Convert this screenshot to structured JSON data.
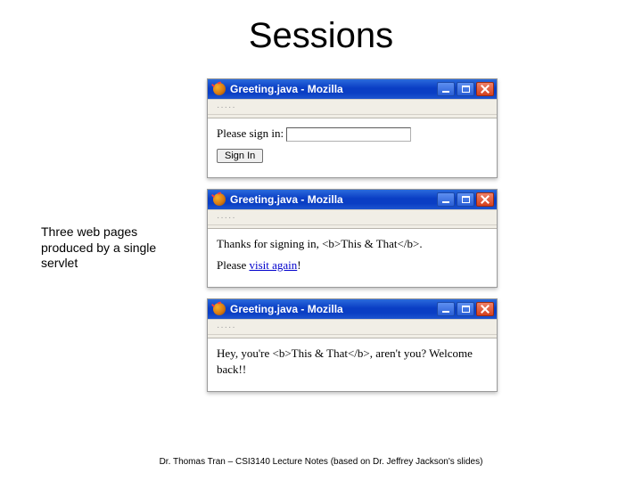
{
  "title": "Sessions",
  "caption": "Three web pages produced by a single servlet",
  "footer": "Dr. Thomas Tran – CSI3140 Lecture Notes (based on Dr. Jeffrey Jackson's slides)",
  "window_title": "Greeting.java - Mozilla",
  "menubar_placeholder": "·····",
  "win1": {
    "label": "Please sign in:",
    "input_value": "",
    "button": "Sign In"
  },
  "win2": {
    "line1": "Thanks for signing in, <b>This & That</b>.",
    "line2_prefix": "Please ",
    "link": "visit again",
    "line2_suffix": "!"
  },
  "win3": {
    "text": "Hey, you're <b>This & That</b>, aren't you? Welcome back!!"
  }
}
